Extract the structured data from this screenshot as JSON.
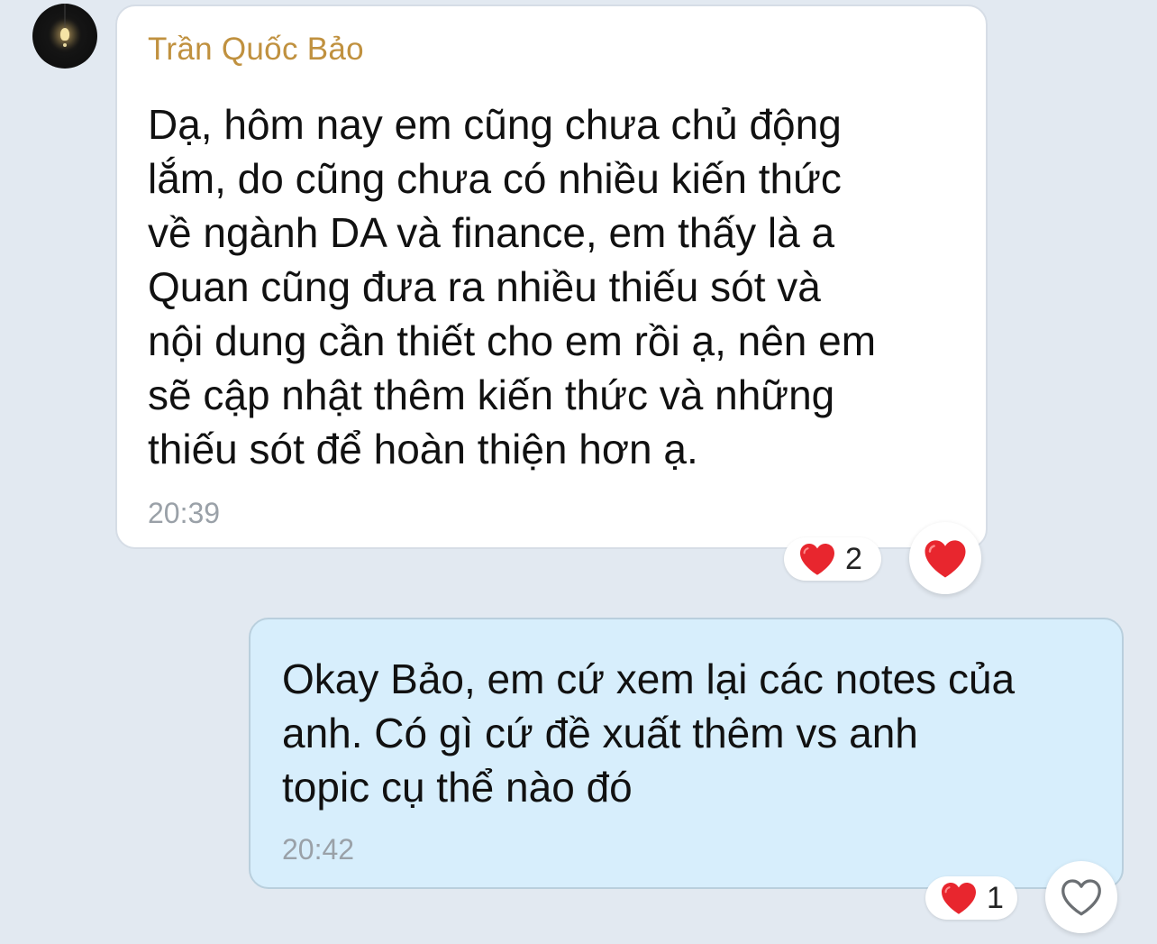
{
  "conversation": {
    "received": {
      "sender_name": "Trần Quốc Bảo",
      "text_lines": [
        "Dạ, hôm nay em cũng chưa chủ động",
        "lắm, do cũng chưa có nhiều kiến thức",
        "về ngành DA và finance, em thấy là a",
        "Quan cũng đưa ra nhiều thiếu sót và",
        "nội dung cần thiết cho em rồi ạ, nên em",
        "sẽ cập nhật thêm kiến thức và những",
        "thiếu sót để hoàn thiện hơn ạ."
      ],
      "time": "20:39",
      "reaction": {
        "icon": "heart-icon",
        "count": "2"
      },
      "react_button_icon": "heart-filled-icon"
    },
    "sent": {
      "text_lines": [
        "Okay Bảo, em cứ xem lại các notes của",
        "anh. Có gì cứ đề xuất thêm vs anh",
        "topic cụ thể nào đó"
      ],
      "time": "20:42",
      "reaction": {
        "icon": "heart-icon",
        "count": "1"
      },
      "react_button_icon": "heart-outline-icon"
    }
  },
  "colors": {
    "background": "#e2e9f1",
    "received_bubble": "#ffffff",
    "sent_bubble": "#d7eefc",
    "sender_name": "#c0913f",
    "heart": "#e8262e",
    "timestamp": "#9aa1a8"
  }
}
